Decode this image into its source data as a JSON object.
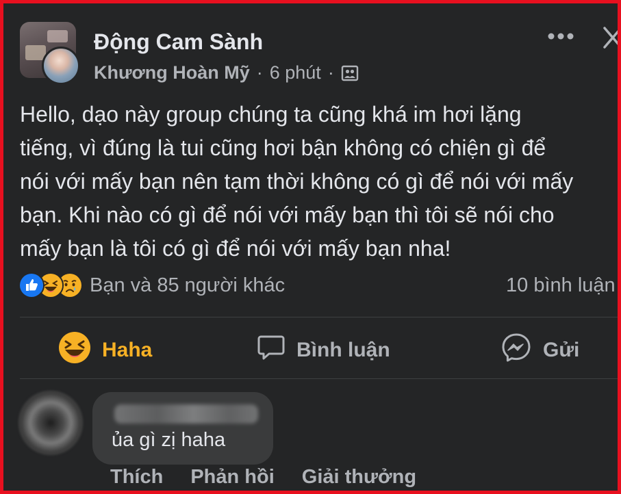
{
  "post": {
    "group_name": "Động Cam Sành",
    "author": "Khương Hoàn Mỹ",
    "separator": "·",
    "time": "6 phút",
    "privacy_icon": "members-icon",
    "more_icon": "more-icon",
    "close_icon": "close-icon",
    "text_lines": [
      "Hello, dạo này group chúng ta cũng khá im hơi lặng",
      "tiếng, vì đúng là tui cũng hơi bận không có chiện gì để",
      "nói với mấy bạn nên tạm thời không có gì để nói với mấy",
      "bạn. Khi nào có gì để nói với mấy bạn thì tôi sẽ nói cho",
      "mấy bạn là tôi có gì để nói với mấy bạn nha!"
    ]
  },
  "reactions": {
    "icons": [
      "like-icon",
      "haha-icon",
      "sad-icon"
    ],
    "summary": "Bạn và 85 người khác",
    "comment_count": "10 bình luận"
  },
  "actions": {
    "haha_label": "Haha",
    "comment_label": "Bình luận",
    "send_label": "Gửi"
  },
  "comment": {
    "text": "ủa gì zị haha",
    "like_label": "Thích",
    "reply_label": "Phản hồi",
    "award_label": "Giải thưởng"
  },
  "colors": {
    "background": "#242526",
    "text": "#e4e6eb",
    "secondary_text": "#b0b3b8",
    "haha_accent": "#f7b125",
    "like_blue": "#1877f2",
    "frame_border": "#e8101f"
  }
}
